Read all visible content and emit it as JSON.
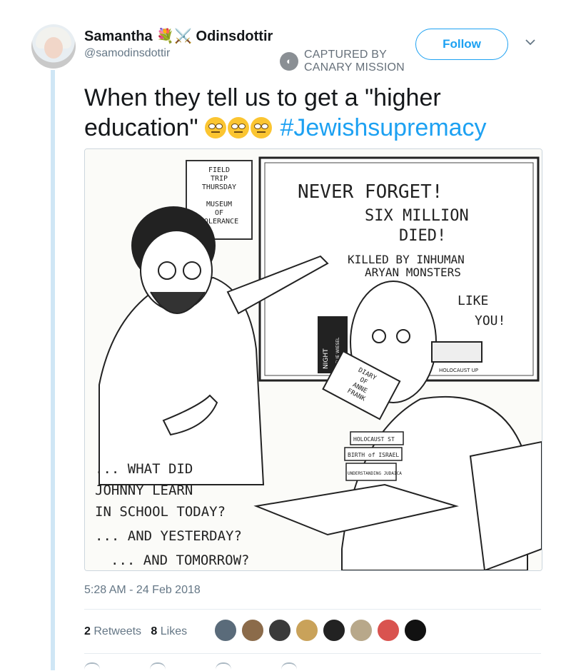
{
  "user": {
    "display_name_part1": "Samantha",
    "display_name_emojis": "💐⚔️",
    "display_name_part2": "Odinsdottir",
    "handle": "@samodinsdottir"
  },
  "watermark": {
    "line1": "CAPTURED BY",
    "line2": "CANARY MISSION",
    "logo_icon": "canary-icon"
  },
  "follow_label": "Follow",
  "tweet": {
    "text_before": "When they tell us to get a \"higher education\"",
    "hashtag": "#Jewishsupremacy",
    "emoji_count": 3
  },
  "cartoon": {
    "sign_field_trip": [
      "FIELD",
      "TRIP",
      "THURSDAY"
    ],
    "sign_museum": [
      "MUSEUM",
      "OF",
      "TOLERANCE"
    ],
    "board": [
      "NEVER FORGET!",
      "SIX MILLION",
      "DIED!",
      "KILLED BY INHUMAN",
      "ARYAN MONSTERS",
      "LIKE",
      "YOU!"
    ],
    "book_night": "NIGHT",
    "book_night_author": "BY ELIE WIESEL",
    "book_diary": [
      "DIARY",
      "OF",
      "ANNE",
      "FRANK"
    ],
    "books_stack": [
      "HOLOCAUST ST",
      "BIRTH of ISRAEL",
      "UNDERSTANDING JUDAICA"
    ],
    "radio_label": "HOLOCAUST UP",
    "caption": [
      "... WHAT DID",
      "JOHNNY LEARN",
      "IN SCHOOL TODAY?",
      "... AND YESTERDAY?",
      "... AND TOMORROW?"
    ]
  },
  "timestamp": "5:28 AM - 24 Feb 2018",
  "stats": {
    "retweets_count": "2",
    "retweets_label": "Retweets",
    "likes_count": "8",
    "likes_label": "Likes"
  },
  "likers": [
    {
      "color": "#5a6b7a"
    },
    {
      "color": "#8b6b4a"
    },
    {
      "color": "#3a3a3a"
    },
    {
      "color": "#c9a25a"
    },
    {
      "color": "#222222"
    },
    {
      "color": "#b8a88a"
    },
    {
      "color": "#d9534f"
    },
    {
      "color": "#111111"
    }
  ]
}
